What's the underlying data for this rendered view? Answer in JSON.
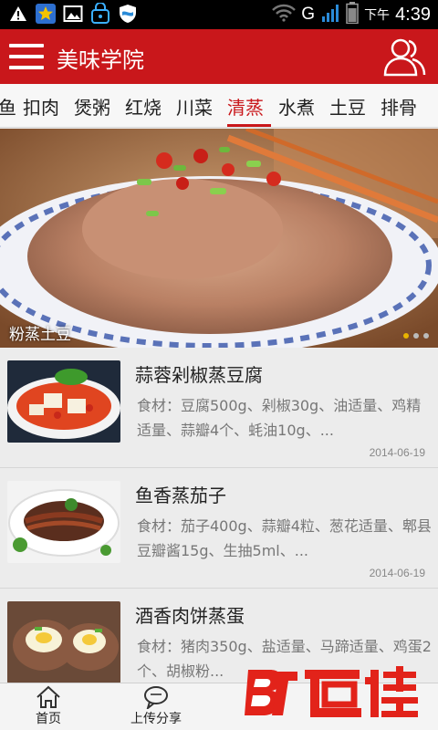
{
  "status_bar": {
    "network": "G",
    "ampm": "下午",
    "time": "4:39",
    "icons": [
      "warning-icon",
      "star-icon",
      "image-icon",
      "key-icon",
      "shield-icon",
      "wifi-icon",
      "signal-icon",
      "battery-icon"
    ]
  },
  "header": {
    "title": "美味学院",
    "background": "#c9171b"
  },
  "tabs": {
    "items": [
      "鱼",
      "扣肉",
      "煲粥",
      "红烧",
      "川菜",
      "清蒸",
      "水煮",
      "土豆",
      "排骨"
    ],
    "active": "清蒸",
    "active_color": "#c9171b"
  },
  "banner": {
    "caption": "粉蒸土豆",
    "slide_count": 3,
    "active_slide": 1
  },
  "recipes": [
    {
      "title": "蒜蓉剁椒蒸豆腐",
      "ingredients": "食材：豆腐500g、剁椒30g、油适量、鸡精适量、蒜瓣4个、蚝油10g、...",
      "date": "2014-06-19"
    },
    {
      "title": "鱼香蒸茄子",
      "ingredients": "食材：茄子400g、蒜瓣4粒、葱花适量、郫县豆瓣酱15g、生抽5ml、...",
      "date": "2014-06-19"
    },
    {
      "title": "酒香肉饼蒸蛋",
      "ingredients": "食材：猪肉350g、盐适量、马蹄适量、鸡蛋2个、胡椒粉...",
      "date": ""
    }
  ],
  "bottom_nav": {
    "items": [
      {
        "label": "首页",
        "icon": "home-icon"
      },
      {
        "label": "上传分享",
        "icon": "chat-bubble-icon"
      }
    ]
  },
  "watermark": {
    "text": "百佳"
  }
}
